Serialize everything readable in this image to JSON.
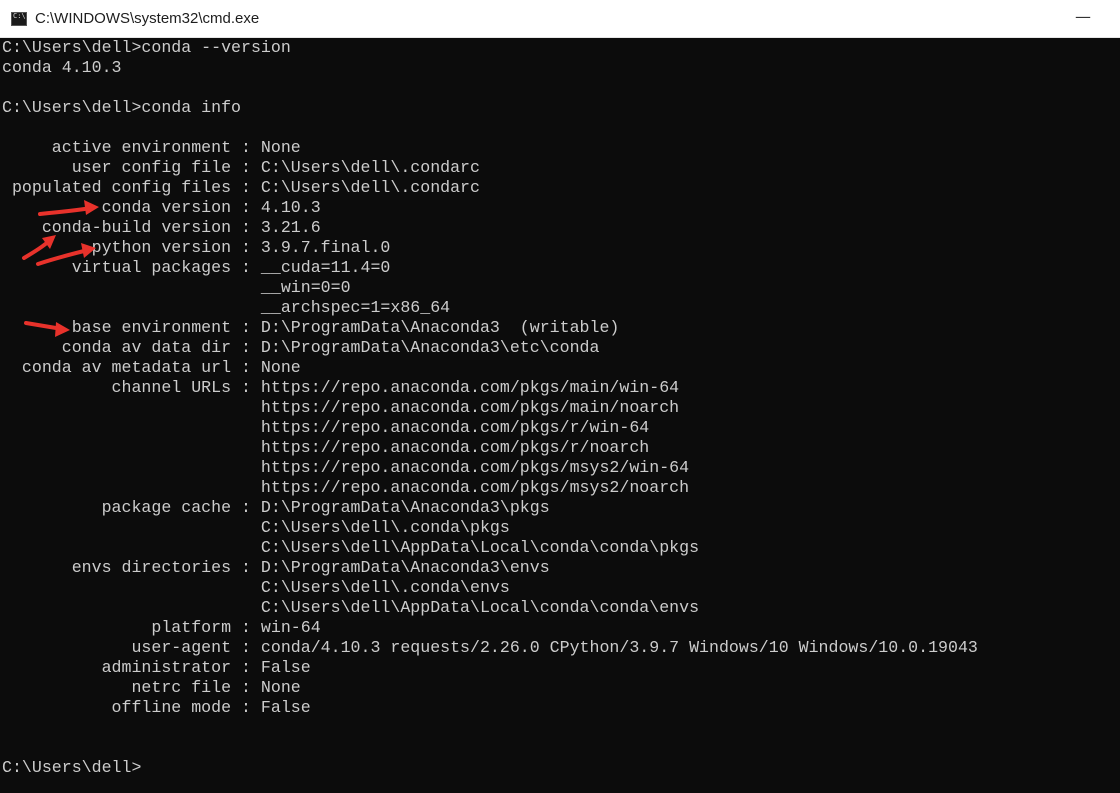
{
  "window": {
    "title": "C:\\WINDOWS\\system32\\cmd.exe",
    "minimize_glyph": "—"
  },
  "console": {
    "lines": [
      "C:\\Users\\dell>conda --version",
      "conda 4.10.3",
      "",
      "C:\\Users\\dell>conda info",
      "",
      "     active environment : None",
      "       user config file : C:\\Users\\dell\\.condarc",
      " populated config files : C:\\Users\\dell\\.condarc",
      "          conda version : 4.10.3",
      "    conda-build version : 3.21.6",
      "         python version : 3.9.7.final.0",
      "       virtual packages : __cuda=11.4=0",
      "                          __win=0=0",
      "                          __archspec=1=x86_64",
      "       base environment : D:\\ProgramData\\Anaconda3  (writable)",
      "      conda av data dir : D:\\ProgramData\\Anaconda3\\etc\\conda",
      "  conda av metadata url : None",
      "           channel URLs : https://repo.anaconda.com/pkgs/main/win-64",
      "                          https://repo.anaconda.com/pkgs/main/noarch",
      "                          https://repo.anaconda.com/pkgs/r/win-64",
      "                          https://repo.anaconda.com/pkgs/r/noarch",
      "                          https://repo.anaconda.com/pkgs/msys2/win-64",
      "                          https://repo.anaconda.com/pkgs/msys2/noarch",
      "          package cache : D:\\ProgramData\\Anaconda3\\pkgs",
      "                          C:\\Users\\dell\\.conda\\pkgs",
      "                          C:\\Users\\dell\\AppData\\Local\\conda\\conda\\pkgs",
      "       envs directories : D:\\ProgramData\\Anaconda3\\envs",
      "                          C:\\Users\\dell\\.conda\\envs",
      "                          C:\\Users\\dell\\AppData\\Local\\conda\\conda\\envs",
      "               platform : win-64",
      "             user-agent : conda/4.10.3 requests/2.26.0 CPython/3.9.7 Windows/10 Windows/10.0.19043",
      "          administrator : False",
      "             netrc file : None",
      "           offline mode : False",
      "",
      "",
      "C:\\Users\\dell>"
    ]
  },
  "annotations": {
    "arrow_color": "#e8322b",
    "arrows": [
      {
        "icon": "red-arrow-icon",
        "points_to": "conda version"
      },
      {
        "icon": "red-arrow-icon",
        "points_to": "python version"
      },
      {
        "icon": "red-arrow-icon",
        "points_to": "python version"
      },
      {
        "icon": "red-arrow-icon",
        "points_to": "base environment"
      }
    ]
  }
}
